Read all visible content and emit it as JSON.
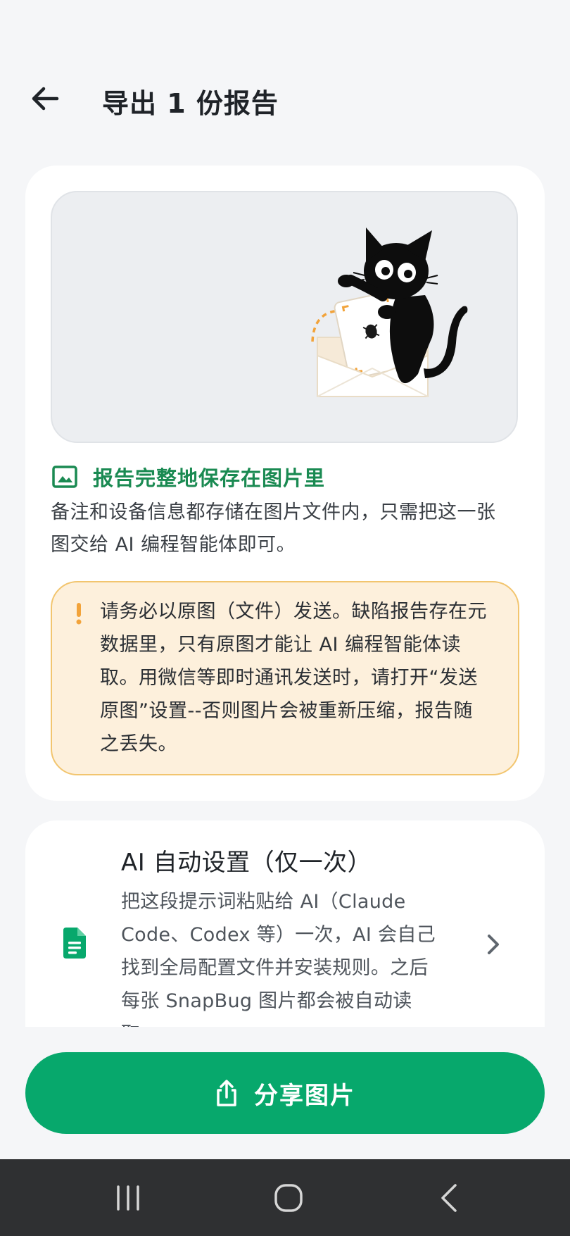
{
  "header": {
    "title": "导出 1 份报告",
    "back_icon": "arrow-left-icon"
  },
  "preview": {
    "illustration": "black cat holding bug report card over envelope"
  },
  "saved": {
    "icon": "image-icon",
    "title": "报告完整地保存在图片里",
    "desc_line1": "备注和设备信息都存储在图片文件内，只需把这一张",
    "desc_line2": "图交给 AI 编程智能体即可。"
  },
  "warning": {
    "icon": "exclamation-icon",
    "line1": "请务必以原图（文件）发送。缺陷报告存在元",
    "line2": "数据里，只有原图才能让 AI 编程智能体读",
    "line3": "取。用微信等即时通讯发送时，请打开“发送",
    "line4": "原图”设置--否则图片会被重新压缩，报告随",
    "line5": "之丢失。"
  },
  "auto_setup": {
    "icon": "document-icon",
    "title": "AI 自动设置（仅一次）",
    "line1": "把这段提示词粘贴给 AI（Claude",
    "line2": "Code、Codex 等）一次，AI 会自己",
    "line3": "找到全局配置文件并安装规则。之后",
    "line4": "每张 SnapBug 图片都会被自动读",
    "line5": "取。",
    "chevron_icon": "chevron-right-icon"
  },
  "share_button": {
    "label": "分享图片",
    "icon": "share-icon"
  },
  "nav": {
    "recents_icon": "recents-icon",
    "home_icon": "home-icon",
    "back_icon": "nav-back-icon"
  },
  "colors": {
    "accent": "#07a86c",
    "accent_text": "#1a8a52",
    "warn_bg": "#fdf0dc",
    "warn_border": "#f2c56f"
  }
}
